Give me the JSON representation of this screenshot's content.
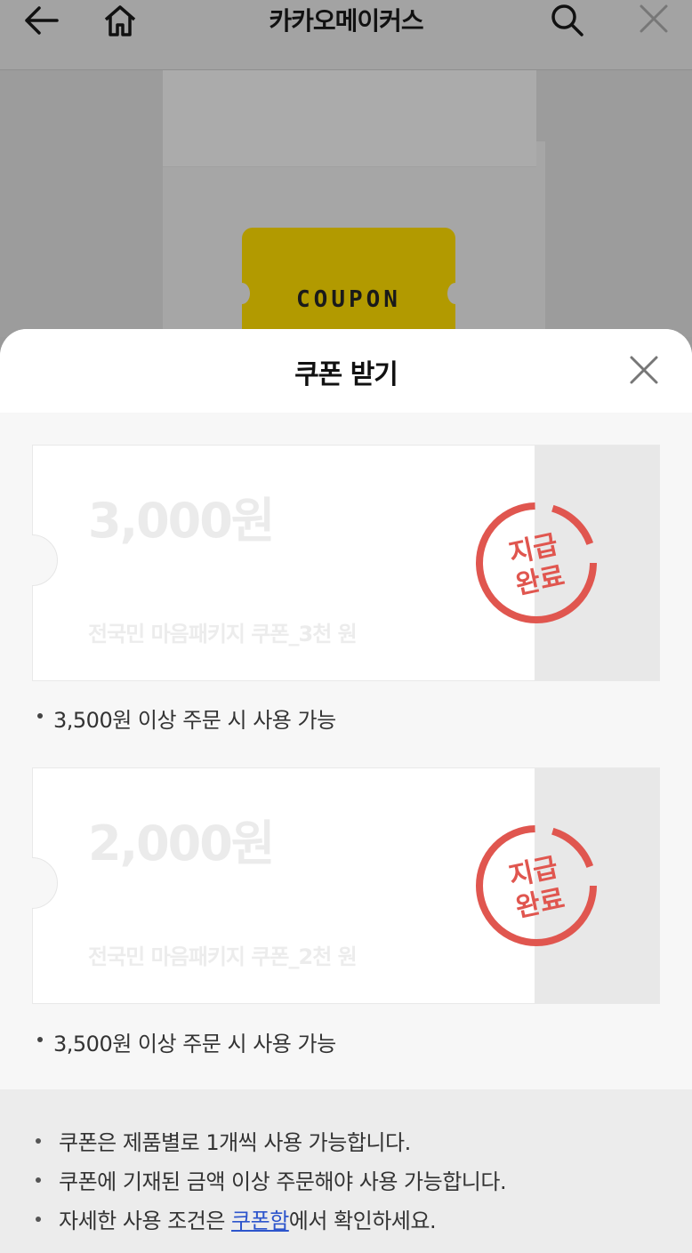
{
  "header": {
    "title": "카카오메이커스",
    "icons": [
      "back-arrow-icon",
      "home-icon",
      "search-icon",
      "close-icon"
    ]
  },
  "promo": {
    "card_text": "COUPON"
  },
  "sheet": {
    "title": "쿠폰 받기",
    "coupons": [
      {
        "amount": "3,000원",
        "name": "전국민 마음패키지 쿠폰_3천 원",
        "stamp_line1": "지급",
        "stamp_line2": "완료",
        "condition": "3,500원 이상 주문 시 사용 가능"
      },
      {
        "amount": "2,000원",
        "name": "전국민 마음패키지 쿠폰_2천 원",
        "stamp_line1": "지급",
        "stamp_line2": "완료",
        "condition": "3,500원 이상 주문 시 사용 가능"
      }
    ],
    "info": {
      "line1": "쿠폰은 제품별로 1개씩 사용 가능합니다.",
      "line2": "쿠폰에 기재된 금액 이상 주문해야 사용 가능합니다.",
      "line3_prefix": "자세한 사용 조건은 ",
      "line3_link": "쿠폰함",
      "line3_suffix": "에서 확인하세요."
    }
  },
  "colors": {
    "stamp": "#e0564f",
    "link": "#2d55cc",
    "coupon_yellow": "#f5d300"
  }
}
